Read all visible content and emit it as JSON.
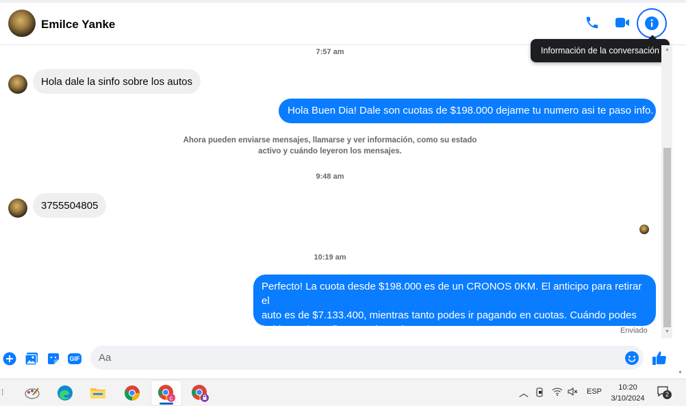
{
  "header": {
    "contact_name": "Emilce Yanke",
    "tooltip": "Información de la conversación",
    "icons": [
      "phone-icon",
      "video-icon",
      "info-icon"
    ]
  },
  "messages": {
    "ts1": "7:57 am",
    "msg1": "Hola dale la sinfo sobre los autos",
    "msg2": "Hola Buen Dia! Dale son cuotas de $198.000 dejame tu numero asi te paso info.",
    "notice_line1": "Ahora pueden enviarse mensajes, llamarse y ver información, como su estado",
    "notice_line2": "activo y cuándo leyeron los mensajes.",
    "ts2": "9:48 am",
    "msg3": "3755504805",
    "ts3": "10:19 am",
    "msg4_line1": "Perfecto! La cuota desde $198.000 es de un CRONOS 0KM. El anticipo para retirar el",
    "msg4_line2": "auto es de $7.133.400, mientras tanto podes ir pagando en cuotas. Cuándo podes",
    "msg4_line3": "hablar? A la mañana o a la tarde?",
    "status": "Enviado"
  },
  "composer": {
    "placeholder": "Aa",
    "icons": [
      "plus-icon",
      "image-icon",
      "sticker-icon",
      "gif-icon",
      "emoji-icon",
      "like-icon"
    ],
    "gif_label": "GIF"
  },
  "taskbar": {
    "apps": [
      "paint-icon",
      "edge-icon",
      "file-explorer-icon",
      "chrome-icon",
      "chrome-profile-c-icon",
      "chrome-profile-lock-icon"
    ],
    "language": "ESP",
    "time": "10:20",
    "date": "3/10/2024",
    "notification_count": "2"
  },
  "colors": {
    "accent": "#0a7cff",
    "incoming_bubble": "#efefef",
    "tooltip_bg": "#1c1e21"
  }
}
